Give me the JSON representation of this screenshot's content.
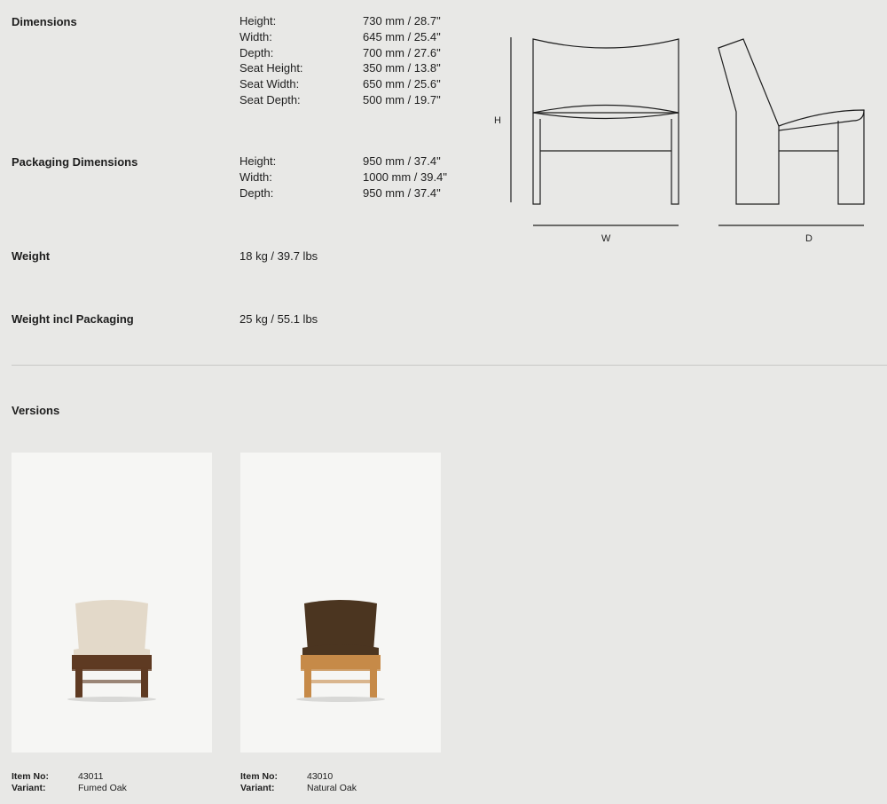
{
  "specs": {
    "dimensions": {
      "label": "Dimensions",
      "rows": [
        {
          "key": "Height:",
          "value": "730 mm / 28.7\""
        },
        {
          "key": "Width:",
          "value": "645 mm / 25.4\""
        },
        {
          "key": "Depth:",
          "value": "700 mm / 27.6\""
        },
        {
          "key": "Seat Height:",
          "value": "350 mm / 13.8\""
        },
        {
          "key": "Seat Width:",
          "value": "650 mm / 25.6\""
        },
        {
          "key": "Seat Depth:",
          "value": "500 mm / 19.7\""
        }
      ]
    },
    "packaging": {
      "label": "Packaging Dimensions",
      "rows": [
        {
          "key": "Height:",
          "value": "950 mm / 37.4\""
        },
        {
          "key": "Width:",
          "value": "1000 mm / 39.4\""
        },
        {
          "key": "Depth:",
          "value": "950 mm / 37.4\""
        }
      ]
    },
    "weight": {
      "label": "Weight",
      "value": "18 kg / 39.7 lbs"
    },
    "weight_pack": {
      "label": "Weight incl Packaging",
      "value": "25 kg / 55.1 lbs"
    }
  },
  "diagram": {
    "h": "H",
    "w": "W",
    "d": "D"
  },
  "versions": {
    "title": "Versions",
    "item_label": "Item No:",
    "variant_label": "Variant:",
    "items": [
      {
        "item_no": "43011",
        "variant": "Fumed Oak",
        "upholstery_color": "#e3d9c9",
        "wood_color": "#5e3a22"
      },
      {
        "item_no": "43010",
        "variant": "Natural Oak",
        "upholstery_color": "#4b3520",
        "wood_color": "#c68a48"
      }
    ]
  }
}
